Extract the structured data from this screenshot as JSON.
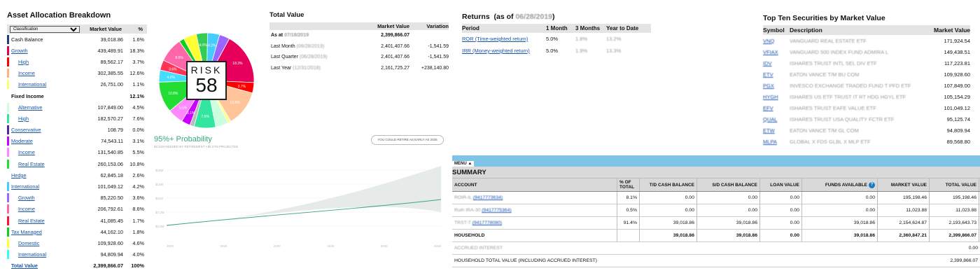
{
  "allocation": {
    "title": "Asset Allocation Breakdown",
    "select_value": "Classification",
    "col_market_value": "Market Value",
    "col_pct": "%",
    "rows": [
      {
        "name": "Cash Balance",
        "value": "39,018.86",
        "pct": "1.6%",
        "color": "#1f3d7a",
        "level": 1,
        "link": false,
        "bold": false
      },
      {
        "name": "Growth",
        "value": "439,489.91",
        "pct": "18.3%",
        "color": "#e0004d",
        "level": 1,
        "link": true,
        "bold": false
      },
      {
        "name": "High",
        "value": "89,562.17",
        "pct": "3.7%",
        "color": "#ff0000",
        "level": 2,
        "link": true,
        "bold": false
      },
      {
        "name": "Income",
        "value": "302,385.55",
        "pct": "12.6%",
        "color": "#ffb380",
        "level": 2,
        "link": true,
        "bold": false
      },
      {
        "name": "International",
        "value": "26,751.00",
        "pct": "1.1%",
        "color": "#ffff66",
        "level": 2,
        "link": true,
        "bold": false
      },
      {
        "name": "Fixed Income",
        "value": "",
        "pct": "12.1%",
        "color": "",
        "level": 1,
        "link": false,
        "bold": true
      },
      {
        "name": "Alternative",
        "value": "107,849.00",
        "pct": "4.5%",
        "color": "#ccffdd",
        "level": 2,
        "link": true,
        "bold": false
      },
      {
        "name": "High",
        "value": "182,570.27",
        "pct": "7.6%",
        "color": "#33e699",
        "level": 2,
        "link": true,
        "bold": false
      },
      {
        "name": "Conservative",
        "value": "108.79",
        "pct": "0.0%",
        "color": "#5522aa",
        "level": 1,
        "link": true,
        "bold": false
      },
      {
        "name": "Moderate",
        "value": "74,543.11",
        "pct": "3.1%",
        "color": "#cc00ff",
        "level": 1,
        "link": true,
        "bold": false
      },
      {
        "name": "Income",
        "value": "131,540.85",
        "pct": "5.5%",
        "color": "#ff88ff",
        "level": 2,
        "link": true,
        "bold": false
      },
      {
        "name": "Real Estate",
        "value": "260,153.06",
        "pct": "10.8%",
        "color": "#22dd33",
        "level": 2,
        "link": true,
        "bold": false
      },
      {
        "name": "Hedge",
        "value": "62,845.18",
        "pct": "2.6%",
        "color": "",
        "level": 1,
        "link": true,
        "bold": false
      },
      {
        "name": "International",
        "value": "101,049.12",
        "pct": "4.2%",
        "color": "#44ccff",
        "level": 1,
        "link": true,
        "bold": false
      },
      {
        "name": "Growth",
        "value": "85,220.50",
        "pct": "3.6%",
        "color": "#9966ff",
        "level": 2,
        "link": true,
        "bold": false
      },
      {
        "name": "Income",
        "value": "206,792.61",
        "pct": "8.6%",
        "color": "#ff66aa",
        "level": 2,
        "link": true,
        "bold": false
      },
      {
        "name": "Real Estate",
        "value": "41,085.45",
        "pct": "1.7%",
        "color": "#ff1133",
        "level": 2,
        "link": true,
        "bold": false
      },
      {
        "name": "Tax Managed",
        "value": "44,162.10",
        "pct": "1.8%",
        "color": "#11cc22",
        "level": 1,
        "link": true,
        "bold": false
      },
      {
        "name": "Domestic",
        "value": "109,928.60",
        "pct": "4.6%",
        "color": "#ffff33",
        "level": 2,
        "link": true,
        "bold": false
      },
      {
        "name": "International",
        "value": "94,809.94",
        "pct": "4.0%",
        "color": "#33ffee",
        "level": 2,
        "link": true,
        "bold": false
      },
      {
        "name": "Total Value",
        "value": "2,399,866.07",
        "pct": "100%",
        "color": "",
        "level": 1,
        "link": true,
        "bold": true
      }
    ]
  },
  "risk": {
    "label": "RISK",
    "score": "58"
  },
  "pie": {
    "slices": [
      {
        "value": 18.3,
        "color": "#e6005c",
        "label": "18.3%"
      },
      {
        "value": 3.7,
        "color": "#ff0000",
        "label": "3.7%"
      },
      {
        "value": 12.6,
        "color": "#ffc49a",
        "label": "12.6%"
      },
      {
        "value": 1.1,
        "color": "#ffff88",
        "label": ""
      },
      {
        "value": 4.5,
        "color": "#ccffdd",
        "label": ""
      },
      {
        "value": 7.6,
        "color": "#33e6a0",
        "label": "7.6%"
      },
      {
        "value": 1.5,
        "color": "#bbbbbb",
        "label": ""
      },
      {
        "value": 3.1,
        "color": "#cc00ff",
        "label": "3.1%"
      },
      {
        "value": 5.5,
        "color": "#ff88ff",
        "label": "5.5%"
      },
      {
        "value": 10.8,
        "color": "#22dd33",
        "label": "10.8%"
      },
      {
        "value": 4.2,
        "color": "#44ddff",
        "label": "4.2%"
      },
      {
        "value": 3.6,
        "color": "#ff3355",
        "label": "3.6%"
      },
      {
        "value": 8.6,
        "color": "#ff66aa",
        "label": "8.6%"
      },
      {
        "value": 1.8,
        "color": "#11cc22",
        "label": ""
      },
      {
        "value": 4.6,
        "color": "#ffff33",
        "label": ""
      },
      {
        "value": 4.0,
        "color": "#33cc55",
        "label": "4.0%"
      },
      {
        "value": 4.2,
        "color": "#44ccff",
        "label": "4.2%"
      },
      {
        "value": 3.6,
        "color": "#9966ff",
        "label": ""
      }
    ]
  },
  "projection": {
    "probability": "95%+ Probability",
    "subtitle": "$2.81M NEEDED BY RETIREMENT • $5.07M PROJECTED",
    "retire_button": "YOU COULD RETIRE AS EARLY AS 2025",
    "y_ticks": [
      "$18M",
      "$14M",
      "$11M",
      "$7.2M",
      "$3.6M"
    ],
    "x_ticks": [
      "2020",
      "2025",
      "2030",
      "2035",
      "2040",
      "2045"
    ]
  },
  "total_value": {
    "title": "Total Value",
    "col_mv": "Market Value",
    "col_var": "Variation",
    "rows": [
      {
        "label": "As at",
        "date": "07/18/2019",
        "mv": "2,399,866.07",
        "var": ""
      },
      {
        "label": "Last Month",
        "date": "(06/28/2019)",
        "mv": "2,401,407.66",
        "var": "-1,541.59"
      },
      {
        "label": "Last Quarter",
        "date": "(06/28/2019)",
        "mv": "2,401,407.66",
        "var": "-1,541.59"
      },
      {
        "label": "Last Year",
        "date": "(12/31/2018)",
        "mv": "2,161,725.27",
        "var": "+238,140.80"
      }
    ]
  },
  "returns": {
    "title": "Returns",
    "as_of_prefix": "(as of",
    "as_of_date": "06/28/2019",
    "as_of_suffix": ")",
    "col_period": "Period",
    "col_1m": "1 Month",
    "col_3m": "3 Months",
    "col_ytd": "Year to Date",
    "rows": [
      {
        "period": "ROR (Time-weighted return)",
        "m1": "5.0%",
        "m3": "1.8%",
        "ytd": "13.2%"
      },
      {
        "period": "IRR (Money-weighted return)",
        "m1": "5.0%",
        "m3": "1.9%",
        "ytd": "13.3%"
      }
    ]
  },
  "top_ten": {
    "title": "Top Ten Securities by Market Value",
    "col_symbol": "Symbol",
    "col_desc": "Description",
    "col_mv": "Market Value",
    "rows": [
      {
        "symbol": "VNQ",
        "desc": "VANGUARD REAL ESTATE ETF",
        "mv": "171,924.54"
      },
      {
        "symbol": "VFIAX",
        "desc": "VANGUARD 500 INDEX FUND ADMIRA L",
        "mv": "149,438.51"
      },
      {
        "symbol": "IDV",
        "desc": "ISHARES TRUST INTL SEL DIV ETF",
        "mv": "117,223.81"
      },
      {
        "symbol": "ETV",
        "desc": "EATON VANCE T/M BU COM",
        "mv": "109,928.60"
      },
      {
        "symbol": "PGX",
        "desc": "INVESCO EXCHANGE TRADED FUND T PFD ETF",
        "mv": "107,849.00"
      },
      {
        "symbol": "HYGH",
        "desc": "ISHARES US ETF TRUST IT RT HDG HGYL ETF",
        "mv": "105,154.29"
      },
      {
        "symbol": "EFV",
        "desc": "ISHARES TRUST EAFE VALUE ETF",
        "mv": "101,049.12"
      },
      {
        "symbol": "QUAL",
        "desc": "ISHARES TRUST USA QUALITY FCTR ETF",
        "mv": "95,125.74"
      },
      {
        "symbol": "ETW",
        "desc": "EATON VANCE T/M GL COM",
        "mv": "94,809.94"
      },
      {
        "symbol": "MLPA",
        "desc": "GLOBAL X FDS GLBL X MLP ETF",
        "mv": "89,568.80"
      }
    ]
  },
  "summary": {
    "menu_label": "MENU",
    "title": "SUMMARY",
    "headers": {
      "account": "ACCOUNT",
      "pct": "% OF TOTAL",
      "td": "T/D CASH BALANCE",
      "sd": "S/D CASH BALANCE",
      "loan": "LOAN VALUE",
      "funds": "FUNDS AVAILABLE",
      "mv": "MARKET VALUE",
      "total": "TOTAL VALUE"
    },
    "rows": [
      {
        "account": "ROIR-IL",
        "acct_no": "(9417773634)",
        "pct": "8.1%",
        "td": "0.00",
        "sd": "0.00",
        "loan": "0.00",
        "funds": "0.00",
        "mv": "195,198.46",
        "total": "195,198.46"
      },
      {
        "account": "Ruth IRA-30",
        "acct_no": "(9417775364)",
        "pct": "0.5%",
        "td": "0.00",
        "sd": "0.00",
        "loan": "0.00",
        "funds": "0.00",
        "mv": "11,023.88",
        "total": "11,023.88"
      },
      {
        "account": "TRST-T",
        "acct_no": "(9417778080)",
        "pct": "91.4%",
        "td": "39,018.86",
        "sd": "39,018.86",
        "loan": "0.00",
        "funds": "39,018.86",
        "mv": "2,154,624.87",
        "total": "2,193,643.73"
      }
    ],
    "household": {
      "label": "HOUSEHOLD",
      "td": "39,018.86",
      "sd": "39,018.86",
      "loan": "0.00",
      "funds": "39,018.86",
      "mv": "2,360,847.21",
      "total": "2,399,866.07"
    },
    "accrued_label": "ACCRUED INTEREST",
    "accrued_value": "0.00",
    "hh_total_label": "HOUSEHOLD TOTAL VALUE (INCLUDING ACCRUED INTEREST)",
    "hh_total_value": "2,399,866.07"
  }
}
